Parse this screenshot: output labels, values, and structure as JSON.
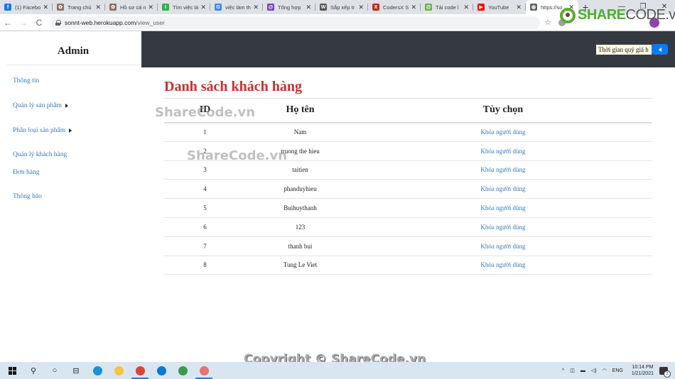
{
  "browser": {
    "tabs": [
      {
        "label": "(1) Facebo",
        "icon": "facebook-icon",
        "color": "#1877f2",
        "glyph": "f"
      },
      {
        "label": "Trang chủ",
        "icon": "site-icon",
        "color": "#8d6e63",
        "glyph": "✿"
      },
      {
        "label": "Hồ sơ cá n",
        "icon": "site-icon",
        "color": "#8d6e63",
        "glyph": "✿"
      },
      {
        "label": "Tìm việc là",
        "icon": "jobs-icon",
        "color": "#2fb34a",
        "glyph": "I"
      },
      {
        "label": "việc làm th",
        "icon": "google-icon",
        "color": "#4285f4",
        "glyph": "G"
      },
      {
        "label": "Tổng hợp",
        "icon": "at-icon",
        "color": "#7b3fb3",
        "glyph": "@"
      },
      {
        "label": "Sắp xếp tr",
        "icon": "wikipedia-icon",
        "color": "#555555",
        "glyph": "W"
      },
      {
        "label": "CodersX S",
        "icon": "codersx-icon",
        "color": "#c62828",
        "glyph": "X"
      },
      {
        "label": "Tải code l",
        "icon": "sharecode-icon",
        "color": "#6ab04c",
        "glyph": "@"
      },
      {
        "label": "YouTube",
        "icon": "youtube-icon",
        "color": "#ff0000",
        "glyph": "▶"
      },
      {
        "label": "https://so",
        "icon": "globe-icon",
        "color": "#5f6368",
        "glyph": "◍",
        "active": true
      }
    ],
    "new_tab": "+",
    "window_controls": {
      "minimize": "—",
      "maximize": "❐",
      "close": "✕"
    },
    "nav": {
      "back": "←",
      "forward": "→",
      "reload": "C"
    },
    "url_host": "sonnt-web.herokuapp.com",
    "url_path": "/view_user",
    "bookmark_icon": "☆"
  },
  "watermark": {
    "logo_share": "SHARE",
    "logo_code": "CODE.vn",
    "text1": "ShareCode.vn",
    "text2": "ShareCode.vn",
    "copyright": "Copyright © ShareCode.vn"
  },
  "sidebar": {
    "title": "Admin",
    "items": [
      {
        "label": "Thông tin",
        "has_submenu": false
      },
      {
        "label": "Quản lý sản phẩm",
        "has_submenu": true
      },
      {
        "label": "Phân loại sản phẩm",
        "has_submenu": true
      },
      {
        "label": "Quản lý khách hàng",
        "has_submenu": false
      },
      {
        "label": "Đơn hàng",
        "has_submenu": false
      },
      {
        "label": "Thông báo",
        "has_submenu": false
      }
    ]
  },
  "topbar": {
    "marquee_text": "Thời gian quý giá h",
    "toggle_icon": "caret-left-icon"
  },
  "main": {
    "title": "Danh sách khách hàng",
    "columns": [
      "ID",
      "Họ tên",
      "Tùy chọn"
    ],
    "rows": [
      {
        "id": "1",
        "name": "Nam",
        "action": "Khóa người dùng"
      },
      {
        "id": "2",
        "name": "truong the hieu",
        "action": "Khóa người dùng"
      },
      {
        "id": "3",
        "name": "taitien",
        "action": "Khóa người dùng"
      },
      {
        "id": "4",
        "name": "phanduyhieu",
        "action": "Khóa người dùng"
      },
      {
        "id": "5",
        "name": "Buihuythanh",
        "action": "Khóa người dùng"
      },
      {
        "id": "6",
        "name": "123",
        "action": "Khóa người dùng"
      },
      {
        "id": "7",
        "name": "thanh bui",
        "action": "Khóa người dùng"
      },
      {
        "id": "8",
        "name": "Tung Le Viet",
        "action": "Khóa người dùng"
      }
    ]
  },
  "taskbar": {
    "apps": [
      {
        "name": "windows-start-icon"
      },
      {
        "name": "search-icon",
        "glyph": "⚲"
      },
      {
        "name": "cortana-icon",
        "glyph": "○"
      },
      {
        "name": "task-view-icon",
        "glyph": "⊟"
      },
      {
        "name": "edge-icon",
        "color": "#1c8fd8"
      },
      {
        "name": "file-explorer-icon",
        "color": "#f4c542"
      },
      {
        "name": "chrome-icon",
        "color": "#db4437",
        "active": true
      },
      {
        "name": "vscode-icon",
        "color": "#0a7acc"
      },
      {
        "name": "app-icon",
        "color": "#3c9a4a"
      },
      {
        "name": "snip-icon",
        "color": "#e57373",
        "active": true
      }
    ],
    "tray": {
      "chevron": "^",
      "language": "ENG",
      "time": "10:14 PM",
      "date": "1/21/2021",
      "notifications": "2"
    }
  }
}
